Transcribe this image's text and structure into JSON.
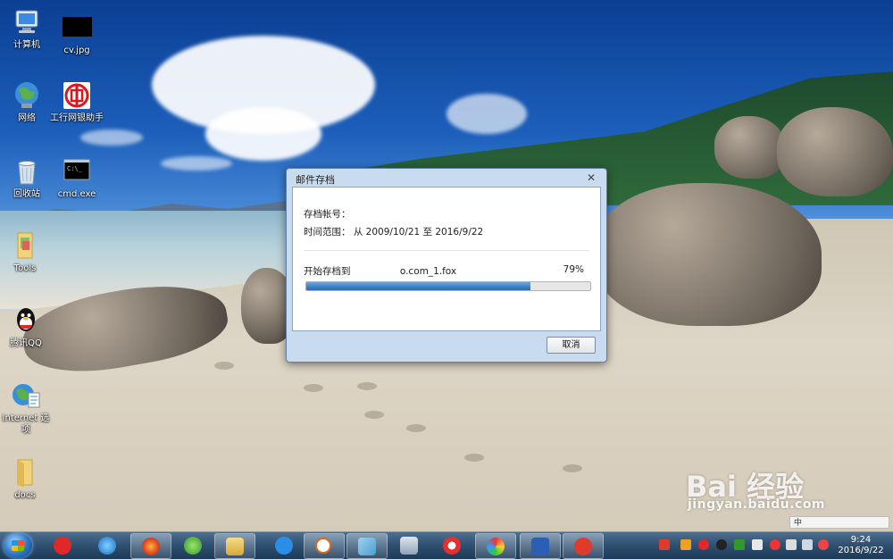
{
  "desktop_icons": [
    {
      "label": "计算机",
      "icon": "computer-icon"
    },
    {
      "label": "cv.jpg",
      "icon": "image-file-icon"
    },
    {
      "label": "网络",
      "icon": "network-icon"
    },
    {
      "label": "工行网银助手",
      "icon": "icbc-icon"
    },
    {
      "label": "回收站",
      "icon": "recycle-bin-icon"
    },
    {
      "label": "cmd.exe",
      "icon": "cmd-icon"
    },
    {
      "label": "Tools",
      "icon": "folder-icon"
    },
    {
      "label": "腾讯QQ",
      "icon": "qq-icon"
    },
    {
      "label": "Internet 选项",
      "icon": "internet-options-icon"
    },
    {
      "label": "docs",
      "icon": "folder-icon"
    }
  ],
  "dialog": {
    "title": "邮件存档",
    "account_label": "存档帐号：",
    "time_range_label": "时间范围：",
    "time_range_value": "从 2009/10/21 至 2016/9/22",
    "status_prefix": "开始存档到",
    "status_file": "o.com_1.fox",
    "progress_percent_text": "79%",
    "progress_value": 0.79,
    "cancel_label": "取消"
  },
  "taskbar": {
    "apps": [
      "start-button",
      "icbc-app",
      "ie-app",
      "firefox-app",
      "app360",
      "explorer-app",
      "baidu-cloud-app",
      "search-app",
      "notepad-app",
      "calculator-app",
      "media-player-app",
      "paint-app",
      "word-app",
      "foxmail-app"
    ],
    "clock_time": "9:24",
    "clock_date": "2016/9/22",
    "ime_label": "中"
  },
  "watermark": {
    "brand": "Bai 经验",
    "url": "jingyan.baidu.com"
  }
}
